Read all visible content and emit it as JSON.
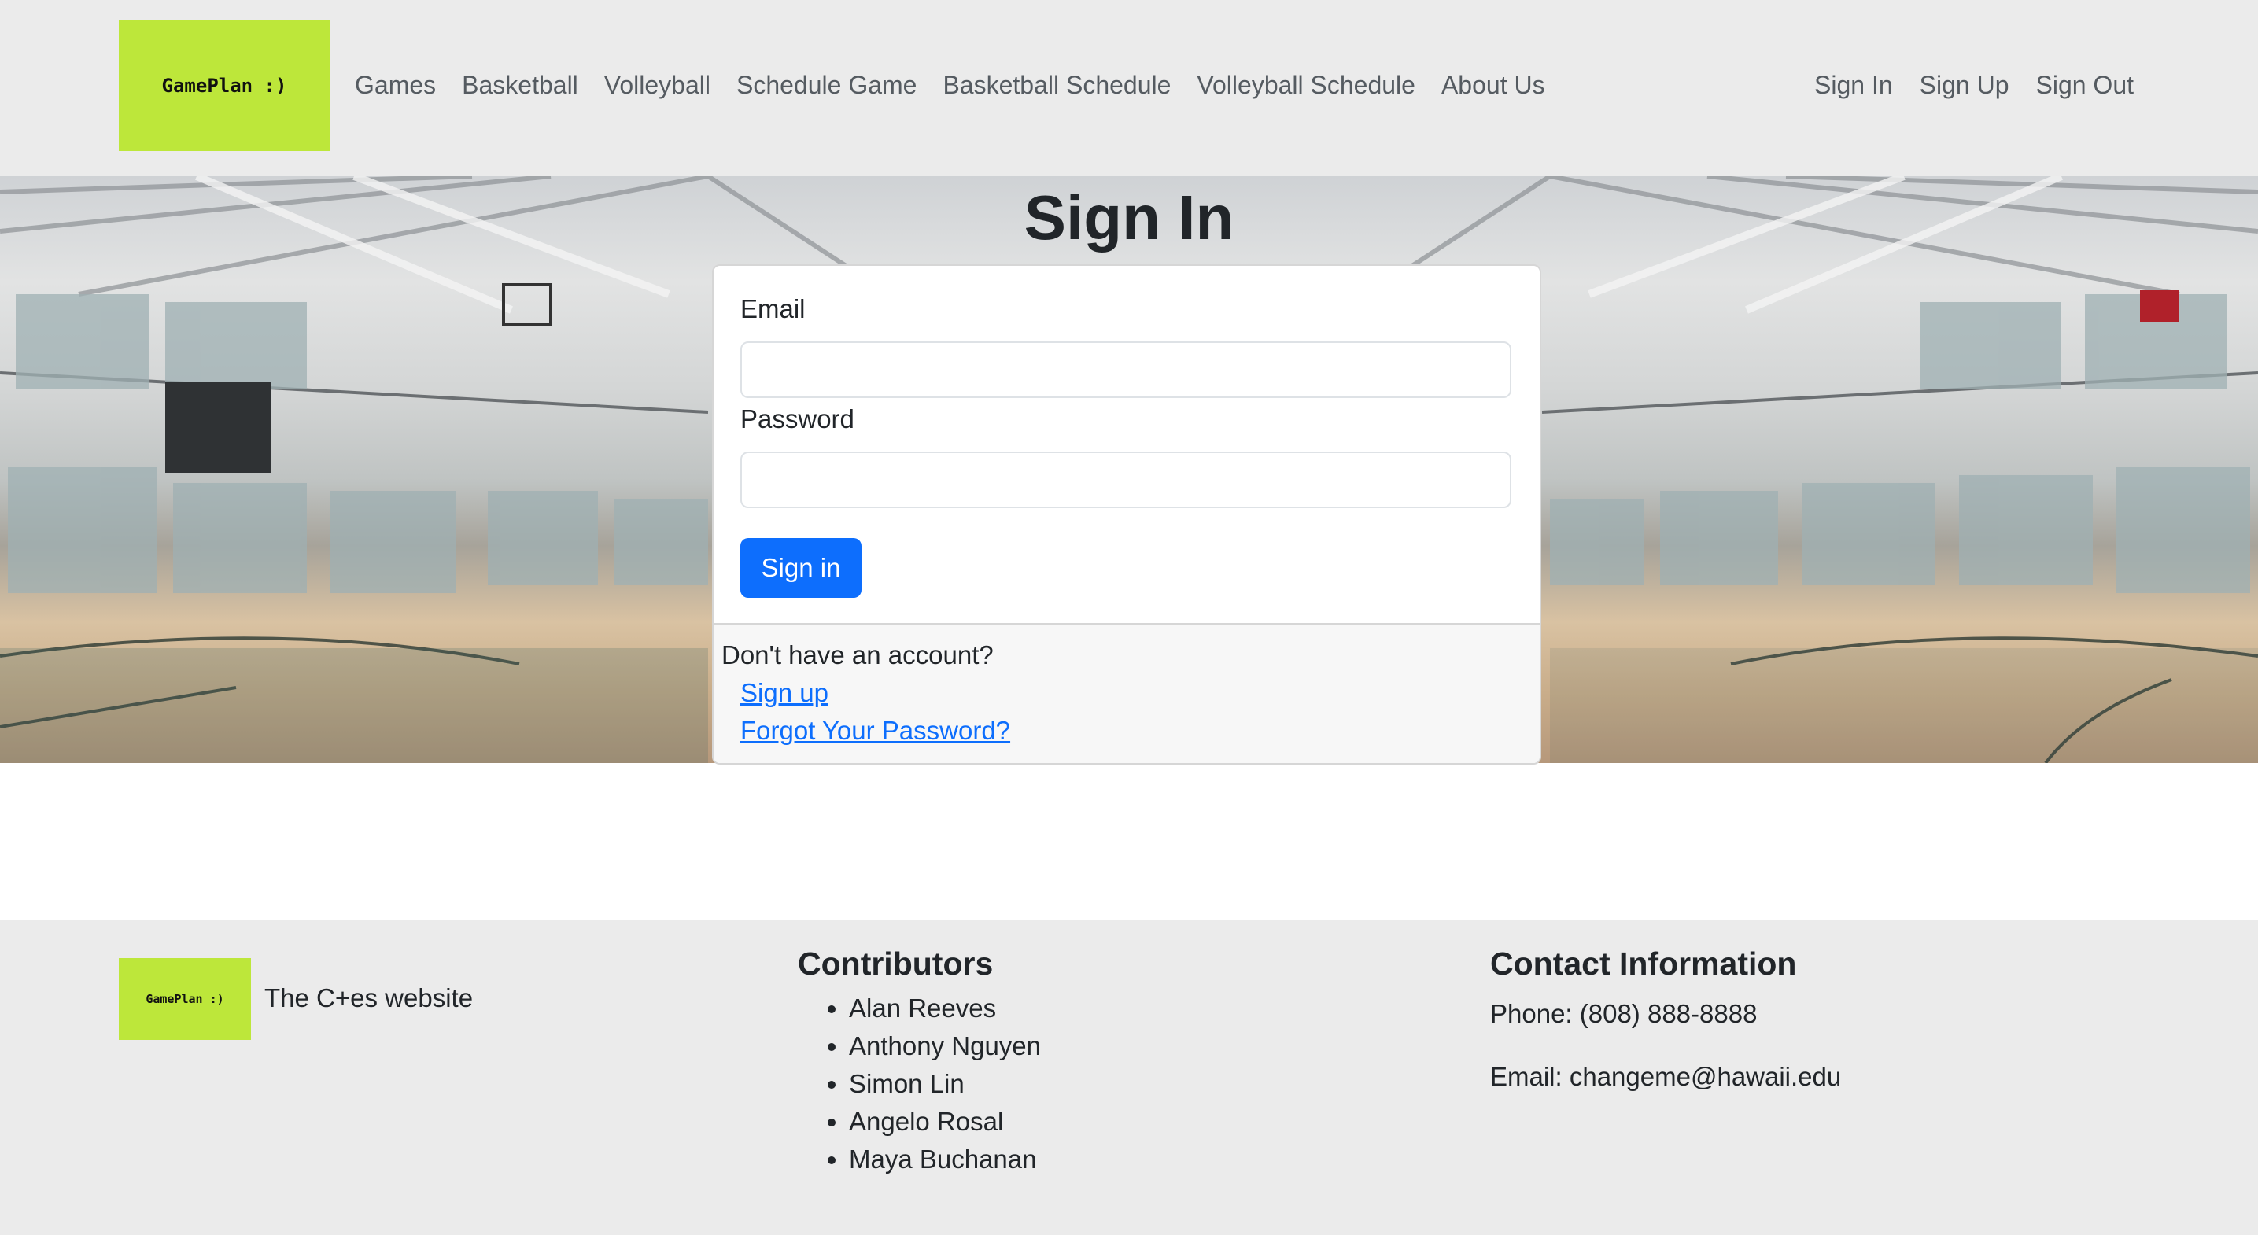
{
  "brand": {
    "logo_text": "GamePlan :)"
  },
  "nav": {
    "left": [
      "Games",
      "Basketball",
      "Volleyball",
      "Schedule Game",
      "Basketball Schedule",
      "Volleyball Schedule",
      "About Us"
    ],
    "right": [
      "Sign In",
      "Sign Up",
      "Sign Out"
    ]
  },
  "page": {
    "title": "Sign In"
  },
  "form": {
    "email_label": "Email",
    "email_value": "",
    "password_label": "Password",
    "password_value": "",
    "submit_label": "Sign in"
  },
  "card_footer": {
    "prompt": "Don't have an account?",
    "signup_link": "Sign up",
    "forgot_link": "Forgot Your Password?"
  },
  "footer": {
    "logo_text": "GamePlan :)",
    "tagline": "The C+es website",
    "contributors_heading": "Contributors",
    "contributors": [
      "Alan Reeves",
      "Anthony Nguyen",
      "Simon Lin",
      "Angelo Rosal",
      "Maya Buchanan"
    ],
    "contact_heading": "Contact Information",
    "phone": "Phone: (808) 888-8888",
    "email": "Email: changeme@hawaii.edu"
  },
  "colors": {
    "navbar_bg": "#ebebeb",
    "logo_bg": "#bde73a",
    "primary": "#0d6efd",
    "text": "#212529"
  }
}
